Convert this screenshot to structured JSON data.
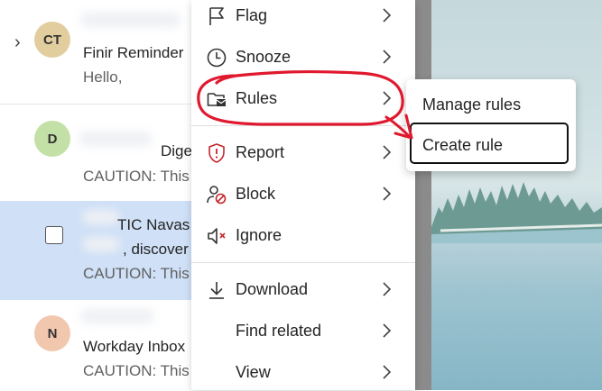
{
  "mail_list": {
    "items": [
      {
        "initials": "CT",
        "avatar_color": "#e2cd9e",
        "line1": "Finir Reminder",
        "line2": "Hello,"
      },
      {
        "initials": "D",
        "avatar_color": "#c3e0a6",
        "line1": "Dige",
        "line2": "CAUTION: This"
      },
      {
        "line1": "TIC Navas",
        "line2": ", discover",
        "line3": "CAUTION: This",
        "selected": true
      },
      {
        "initials": "N",
        "avatar_color": "#f1c8ae",
        "line1": "Workday Inbox",
        "line2": "CAUTION: This"
      }
    ],
    "selected_bg": "#cfe0f7"
  },
  "context_menu": {
    "items": [
      {
        "label": "Flag",
        "icon": "flag-icon"
      },
      {
        "label": "Snooze",
        "icon": "clock-icon"
      },
      {
        "label": "Rules",
        "icon": "rules-folder-icon"
      },
      {
        "label": "Report",
        "icon": "shield-alert-icon"
      },
      {
        "label": "Block",
        "icon": "block-icon"
      },
      {
        "label": "Ignore",
        "icon": "ignore-speaker-icon"
      },
      {
        "label": "Download",
        "icon": "download-icon"
      },
      {
        "label": "Find related",
        "icon": ""
      },
      {
        "label": "View",
        "icon": ""
      }
    ]
  },
  "submenu": {
    "items": [
      {
        "label": "Manage rules"
      },
      {
        "label": "Create rule"
      }
    ]
  },
  "colors": {
    "annotation_red": "#e0192f",
    "menu_text": "#242424"
  }
}
